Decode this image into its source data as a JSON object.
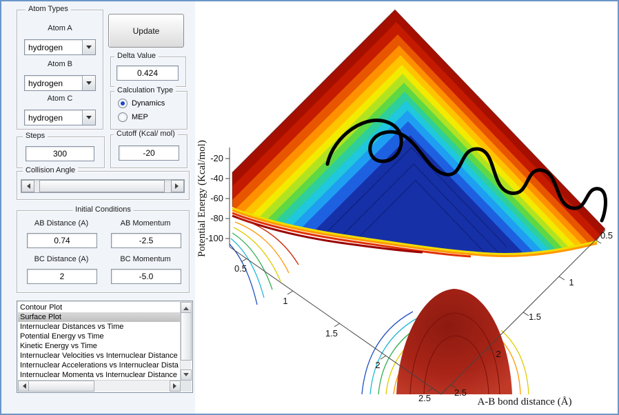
{
  "panels": {
    "atom_types": {
      "title": "Atom Types",
      "atoms": [
        {
          "label": "Atom A",
          "value": "hydrogen"
        },
        {
          "label": "Atom B",
          "value": "hydrogen"
        },
        {
          "label": "Atom C",
          "value": "hydrogen"
        }
      ]
    },
    "update_button_label": "Update",
    "delta": {
      "title": "Delta Value",
      "value": "0.424"
    },
    "calculation_type": {
      "title": "Calculation Type",
      "options": [
        {
          "label": "Dynamics",
          "selected": true
        },
        {
          "label": "MEP",
          "selected": false
        }
      ]
    },
    "steps": {
      "title": "Steps",
      "value": "300"
    },
    "cutoff": {
      "title": "Cutoff (Kcal/ mol)",
      "value": "-20"
    },
    "collision_angle": {
      "title": "Collision Angle"
    },
    "initial_conditions": {
      "title": "Initial Conditions",
      "fields": [
        {
          "label": "AB Distance (A)",
          "value": "0.74"
        },
        {
          "label": "AB Momentum",
          "value": "-2.5"
        },
        {
          "label": "BC Distance (A)",
          "value": "2"
        },
        {
          "label": "BC Momentum",
          "value": "-5.0"
        }
      ]
    },
    "plot_list": {
      "items": [
        "Contour Plot",
        "Surface Plot",
        "Internuclear Distances vs Time",
        "Potential Energy vs Time",
        "Kinetic Energy vs Time",
        "Internuclear Velocities vs Internuclear Distance",
        "Internuclear Accelerations vs Internuclear Dista",
        "Internuclear Momenta vs Internuclear Distance"
      ],
      "selected_index": 1
    }
  },
  "chart_data": {
    "type": "surface",
    "description": "3D potential energy surface (jet colormap) for a triatomic A-B-C reaction with a black classical dynamics trajectory looping along the entrance valley; high red repulsive wall at small bond distances, deep blue valley, and red dissociation plateau dome at large distances",
    "zlabel": "Potential Energy (Kcal/mol)",
    "xlabel": "A-B bond distance (Å)",
    "z_ticks": [
      "-20",
      "-40",
      "-60",
      "-80",
      "-100"
    ],
    "ab_ticks": [
      "0.5",
      "1",
      "1.5",
      "2",
      "2.5"
    ],
    "bc_ticks": [
      "0.5",
      "1",
      "1.5",
      "2",
      "2.5"
    ],
    "zlim": [
      -110,
      0
    ],
    "ab_range": [
      0.5,
      2.5
    ],
    "bc_range": [
      0.5,
      2.5
    ],
    "colormap": "jet",
    "trajectory_color": "#000000",
    "surface_high_color": "#a50f00",
    "surface_valley_color": "#1630a8"
  }
}
